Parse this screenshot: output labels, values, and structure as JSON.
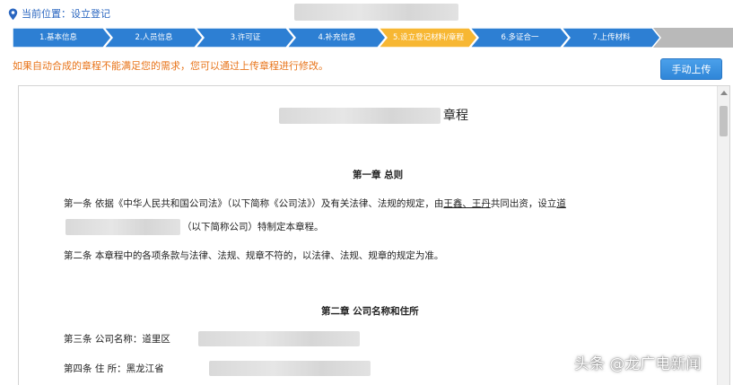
{
  "location": {
    "icon": "location-pin-icon",
    "text": "当前位置：设立登记"
  },
  "steps": [
    {
      "label": "1.基本信息",
      "state": "done"
    },
    {
      "label": "2.人员信息",
      "state": "done"
    },
    {
      "label": "3.许可证",
      "state": "done"
    },
    {
      "label": "4.补充信息",
      "state": "done"
    },
    {
      "label": "5.设立登记材料/章程",
      "state": "active"
    },
    {
      "label": "6.多证合一",
      "state": "done"
    },
    {
      "label": "7.上传材料",
      "state": "done"
    }
  ],
  "colors": {
    "step_done": "#2d7fd3",
    "step_active": "#f7b733",
    "step_rest": "#b9b9b9",
    "notice": "#e8741a",
    "button": "#2f86d8"
  },
  "notice": "如果自动合成的章程不能满足您的需求，您可以通过上传章程进行修改。",
  "upload_button": "手动上传",
  "document": {
    "title_suffix": "章程",
    "chapter1": "第一章  总则",
    "article1_a": "第一条  依据《中华人民共和国公司法》（以下简称《公司法》）及有关法律、法规的规定，由",
    "article1_names": "王鑫、王丹",
    "article1_b": "共同出资，设立",
    "article1_c": "道",
    "article1_d": "（以下简称公司）特制定本章程。",
    "article2": "第二条  本章程中的各项条款与法律、法规、规章不符的，以法律、法规、规章的规定为准。",
    "chapter2": "第二章  公司名称和住所",
    "article3": "第三条  公司名称：道里区",
    "article4": "第四条  住      所：黑龙江省"
  },
  "watermark": "头条 @龙广电新闻"
}
